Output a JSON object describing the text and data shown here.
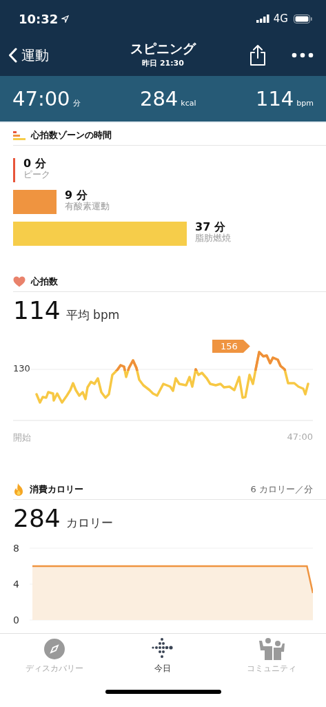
{
  "status_bar": {
    "time": "10:32",
    "network": "4G"
  },
  "nav": {
    "back": "運動",
    "title": "スピニング",
    "subtitle": "昨日 21:30"
  },
  "summary": [
    {
      "value": "47:00",
      "unit": "分"
    },
    {
      "value": "284",
      "unit": "kcal"
    },
    {
      "value": "114",
      "unit": "bpm"
    }
  ],
  "zones": {
    "title": "心拍数ゾーンの時間",
    "items": [
      {
        "minutes": "0 分",
        "label": "ピーク",
        "color": "#e8553a"
      },
      {
        "minutes": "9 分",
        "label": "有酸素運動",
        "color": "#ef9440"
      },
      {
        "minutes": "37 分",
        "label": "脂肪燃焼",
        "color": "#f6cd4a"
      }
    ]
  },
  "heart_rate": {
    "title": "心拍数",
    "average": "114",
    "average_unit": "平均 bpm",
    "y_label": "130",
    "peak_label": "156",
    "x_start": "開始",
    "x_end": "47:00"
  },
  "calories": {
    "title": "消費カロリー",
    "rate": "6 カロリー／分",
    "total": "284",
    "total_unit": "カロリー",
    "chart_data": {
      "type": "area",
      "categories": [
        null,
        null,
        null,
        null,
        null,
        null,
        null,
        null,
        null,
        null,
        null,
        null,
        null,
        null,
        null,
        null,
        null,
        null,
        null,
        null,
        null,
        null,
        null,
        null,
        null,
        null,
        null,
        null,
        null,
        null,
        null,
        null,
        null,
        null,
        null,
        null,
        null,
        null,
        null,
        null,
        null,
        null,
        null,
        null,
        null,
        null,
        null,
        null
      ],
      "series": [
        {
          "color": "#ef9440",
          "values": [
            6,
            6,
            6,
            6,
            6,
            6,
            6,
            6,
            6,
            6,
            6,
            6,
            6,
            6,
            6,
            6,
            6,
            6,
            6,
            6,
            6,
            6,
            6,
            6,
            6,
            6,
            6,
            6,
            6,
            6,
            6,
            6,
            6,
            6,
            6,
            6,
            6,
            6,
            6,
            6,
            6,
            6,
            6,
            6,
            6,
            6,
            6,
            3
          ]
        }
      ],
      "ylim": [
        0,
        8
      ],
      "yticks": [
        {
          "value": 0,
          "label": "0"
        },
        {
          "value": 4,
          "label": "4"
        },
        {
          "value": 8,
          "label": "8"
        }
      ]
    }
  },
  "tabs": [
    {
      "label": "ディスカバリー",
      "selected": false,
      "kind": "discover"
    },
    {
      "label": "今日",
      "selected": true,
      "kind": "today"
    },
    {
      "label": "コミュニティ",
      "selected": false,
      "kind": "community"
    }
  ]
}
